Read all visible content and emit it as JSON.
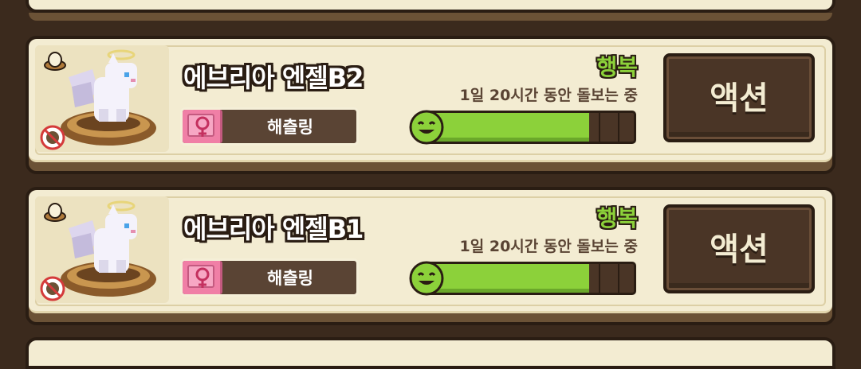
{
  "pets": [
    {
      "name": "에브리아 엔젤B2",
      "stage": "해츨링",
      "gender": "female",
      "mood_label": "행복",
      "care_text": "1일 20시간 동안 돌보는 중",
      "mood_level_pct": 79,
      "action_label": "액션"
    },
    {
      "name": "에브리아 엔젤B1",
      "stage": "해츨링",
      "gender": "female",
      "mood_label": "행복",
      "care_text": "1일 20시간 동안 돌보는 중",
      "mood_level_pct": 79,
      "action_label": "액션"
    }
  ],
  "colors": {
    "mood_green": "#8cd13a",
    "female_pink": "#f07fa6",
    "panel_cream": "#f3ecd2",
    "frame_brown": "#2a1d13"
  },
  "icons": [
    "egg-icon",
    "angel-pet-sprite",
    "no-breeding-icon",
    "female-icon",
    "smile-icon"
  ]
}
